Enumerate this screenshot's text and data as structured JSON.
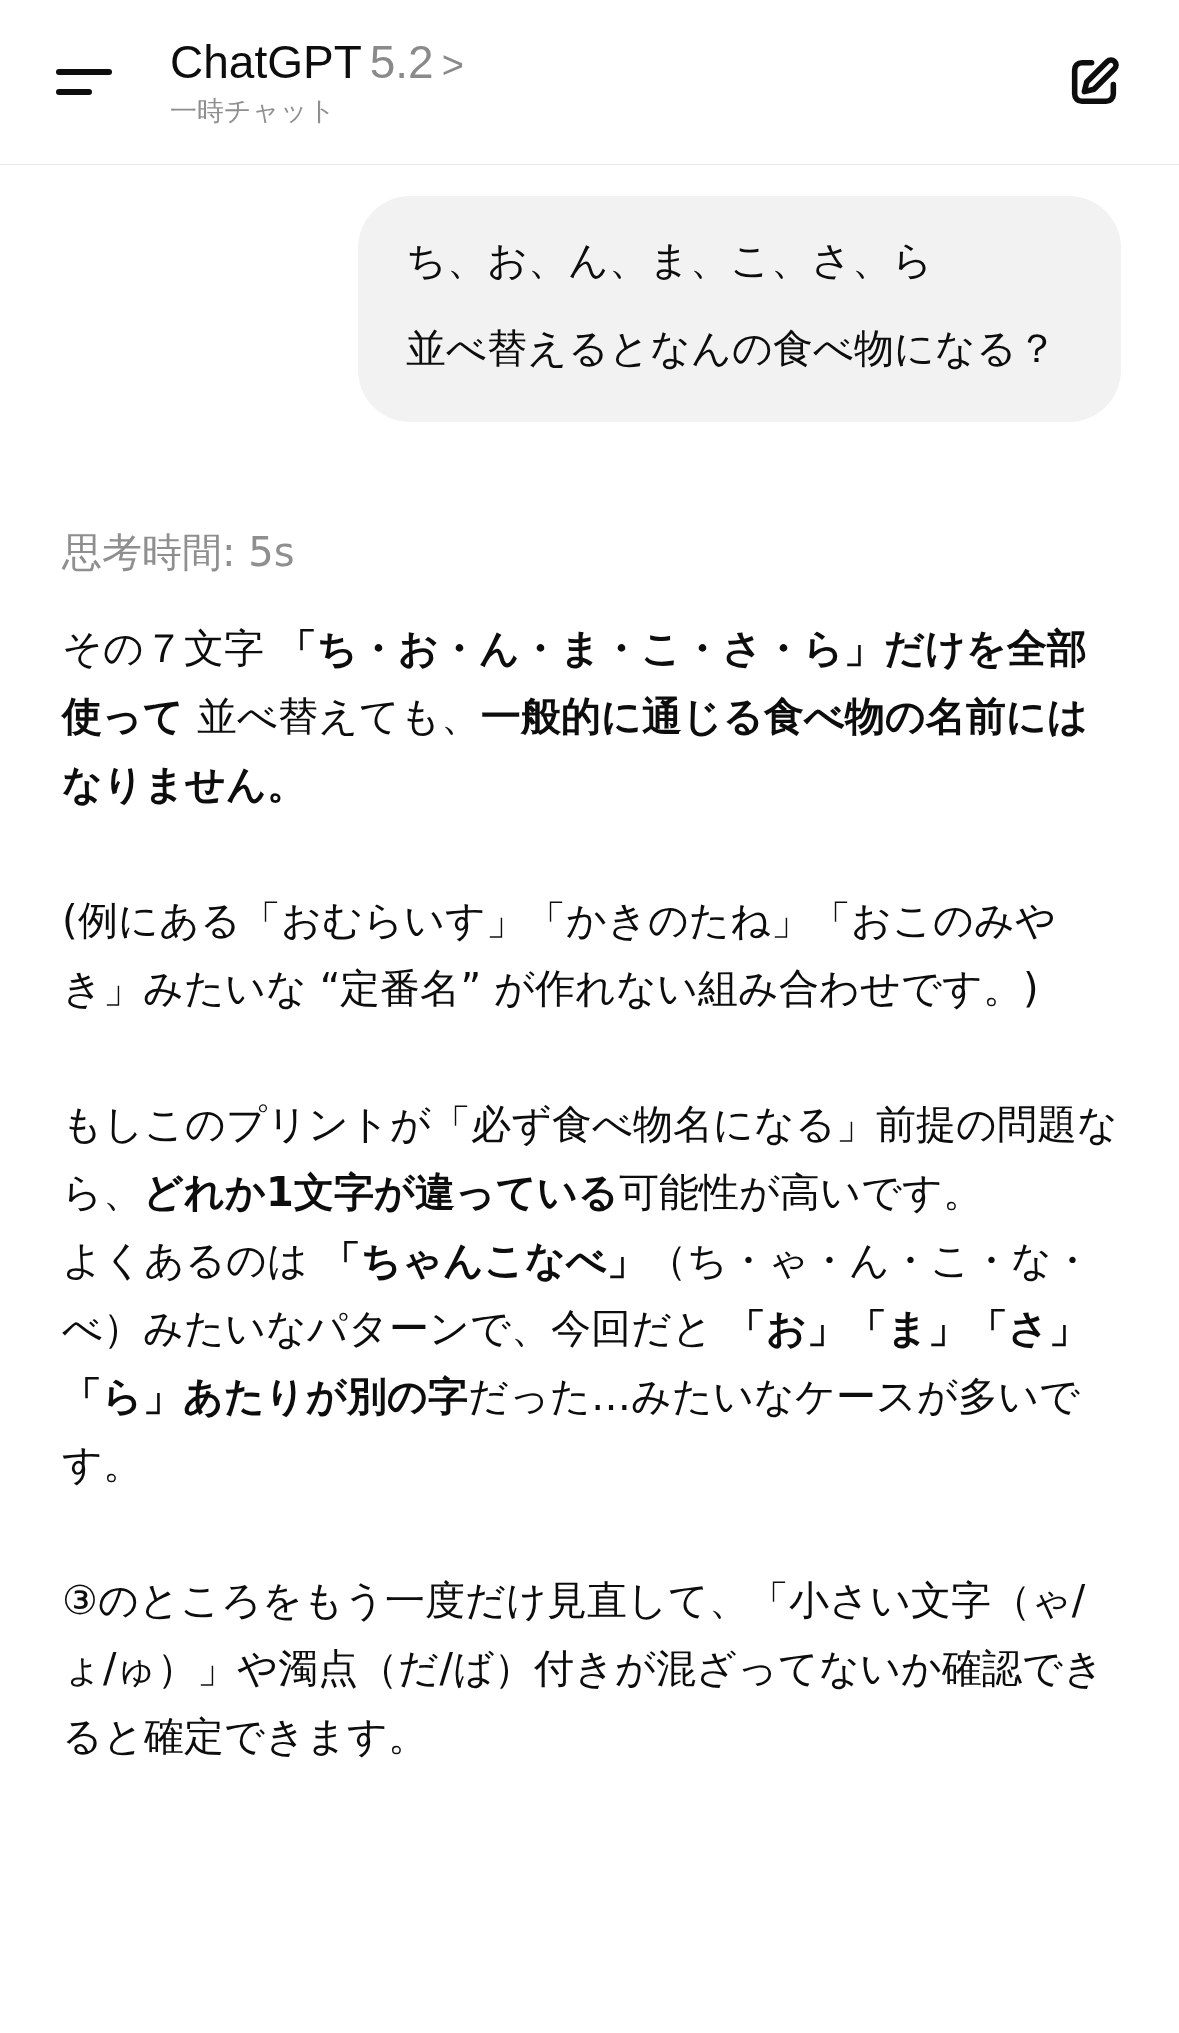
{
  "header": {
    "title": "ChatGPT",
    "model": "5.2",
    "chevron": ">",
    "subtitle": "一時チャット"
  },
  "user_message": {
    "paragraphs": [
      "ち、お、ん、ま、こ、さ、ら",
      "並べ替えるとなんの食べ物になる？"
    ]
  },
  "thinking": "思考時間: 5s",
  "answer": [
    {
      "lines": [
        "その７文字 **「ち・お・ん・ま・こ・さ・ら」だけを全部使って** 並べ替えても、**一般的に通じる食べ物の名前にはなりません。**"
      ]
    },
    {
      "lines": [
        "(例にある「おむらいす」「かきのたね」「おこのみやき」みたいな “定番名” が作れない組み合わせです。)"
      ]
    },
    {
      "lines": [
        "もしこのプリントが「必ず食べ物名になる」前提の問題なら、**どれか1文字が違っている**可能性が高いです。",
        "よくあるのは **「ちゃんこなべ」**（ち・ゃ・ん・こ・な・べ）みたいなパターンで、今回だと **「お」「ま」「さ」「ら」あたりが別の字**だった…みたいなケースが多いです。"
      ]
    },
    {
      "lines": [
        "③のところをもう一度だけ見直して、「小さい文字（ゃ/ょ/ゅ）」や濁点（だ/ば）付きが混ざってないか確認できると確定できます。"
      ]
    }
  ]
}
